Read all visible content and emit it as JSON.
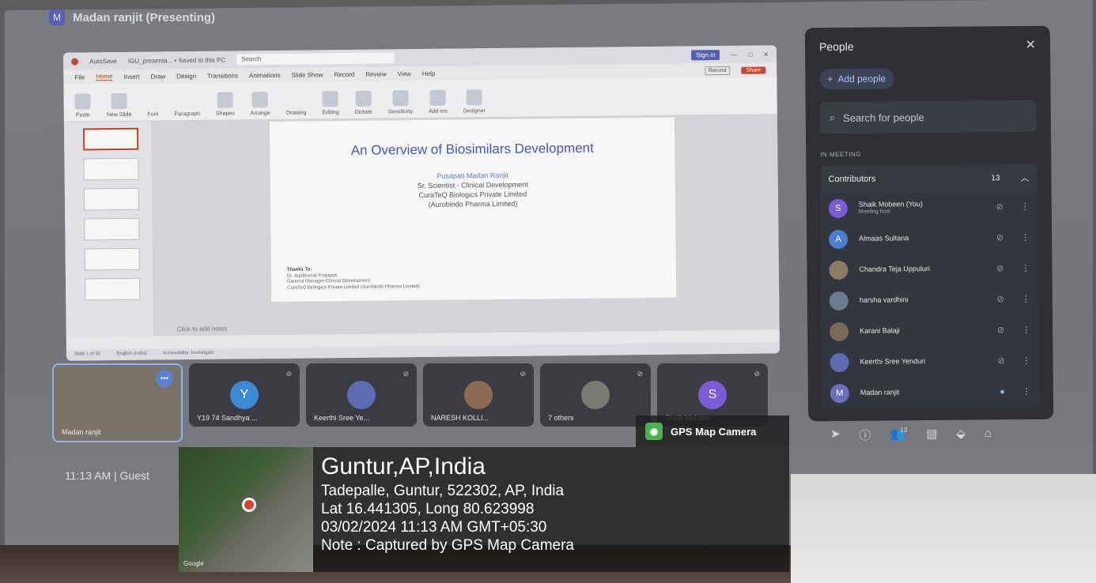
{
  "presenter": {
    "avatar_letter": "M",
    "name": "Madan ranjit (Presenting)"
  },
  "ppt": {
    "title_bar": {
      "autosave": "AutoSave",
      "file_name": "IGU_presenta... • Saved to this PC",
      "search": "Search",
      "sign_in": "Sign in"
    },
    "menu": [
      "File",
      "Home",
      "Insert",
      "Draw",
      "Design",
      "Transitions",
      "Animations",
      "Slide Show",
      "Record",
      "Review",
      "View",
      "Help"
    ],
    "record_label": "Record",
    "share_label": "Share",
    "ribbon": [
      "Paste",
      "New Slide",
      "Font",
      "Paragraph",
      "Shapes",
      "Arrange",
      "Drawing",
      "Editing",
      "Dictate",
      "Sensitivity",
      "Add-ins",
      "Designer"
    ],
    "slide": {
      "title": "An Overview of Biosimilars Development",
      "author": "Pusapati Madan Ranjit",
      "role": "Sr. Scientist - Clinical Development",
      "company": "CuraTeQ Biologics Private Limited",
      "parent": "(Aurobindo Pharma Limited)",
      "thanks_heading": "Thanks To:",
      "thanks_name": "Dr. Arpitkumar Prajapati",
      "thanks_role": "General Manager-Clinical Development",
      "thanks_company": "CuraTeQ Biologics Private Limited (Aurobindo Pharma Limited)"
    },
    "notes_placeholder": "Click to add notes",
    "status": {
      "slide_count": "Slide 1 of 31",
      "language": "English (India)",
      "accessibility": "Accessibility: Investigate"
    }
  },
  "people": {
    "title": "People",
    "add_people": "Add people",
    "search_placeholder": "Search for people",
    "section": "IN MEETING",
    "group_label": "Contributors",
    "group_count": "13",
    "members": [
      {
        "initial": "S",
        "name": "Shaik Mobeen (You)",
        "sub": "Meeting host",
        "color": "#7c5cd6"
      },
      {
        "initial": "A",
        "name": "Almaas Sultana",
        "sub": "",
        "color": "#4a7fd6"
      },
      {
        "initial": "",
        "name": "Chandra Teja Uppuluri",
        "sub": "",
        "color": "#8d7a62"
      },
      {
        "initial": "",
        "name": "harsha vardhini",
        "sub": "",
        "color": "#6a7d8f"
      },
      {
        "initial": "",
        "name": "Karani Balaji",
        "sub": "",
        "color": "#7a6a5a"
      },
      {
        "initial": "",
        "name": "Keerthi Sree Yenduri",
        "sub": "",
        "color": "#5c6cb0"
      },
      {
        "initial": "M",
        "name": "Madan ranjit",
        "sub": "",
        "color": "#6a70c0"
      }
    ],
    "toolbar_badge": "13"
  },
  "tiles": [
    {
      "label": "Madan ranjit",
      "initial": "",
      "color": ""
    },
    {
      "label": "Y19 74 Sandhya ...",
      "initial": "Y",
      "color": "#3c8ad6"
    },
    {
      "label": "Keerthi Sree Ye...",
      "initial": "",
      "color": "#5c6cb0"
    },
    {
      "label": "NARESH KOLLI...",
      "initial": "",
      "color": "#8b6b52"
    },
    {
      "label": "7 others",
      "initial": "",
      "color": "#7a7a72"
    },
    {
      "label": "Shaik Mobeen",
      "initial": "S",
      "color": "#7c5cd6"
    }
  ],
  "clock": "11:13 AM  |  Guest",
  "gps": {
    "app_name": "GPS Map Camera",
    "city": "Guntur,AP,India",
    "address": "Tadepalle, Guntur, 522302, AP, India",
    "coords": "Lat 16.441305, Long 80.623998",
    "datetime": "03/02/2024 11:13 AM GMT+05:30",
    "note": "Note : Captured by GPS Map Camera",
    "map_label": "Google"
  }
}
